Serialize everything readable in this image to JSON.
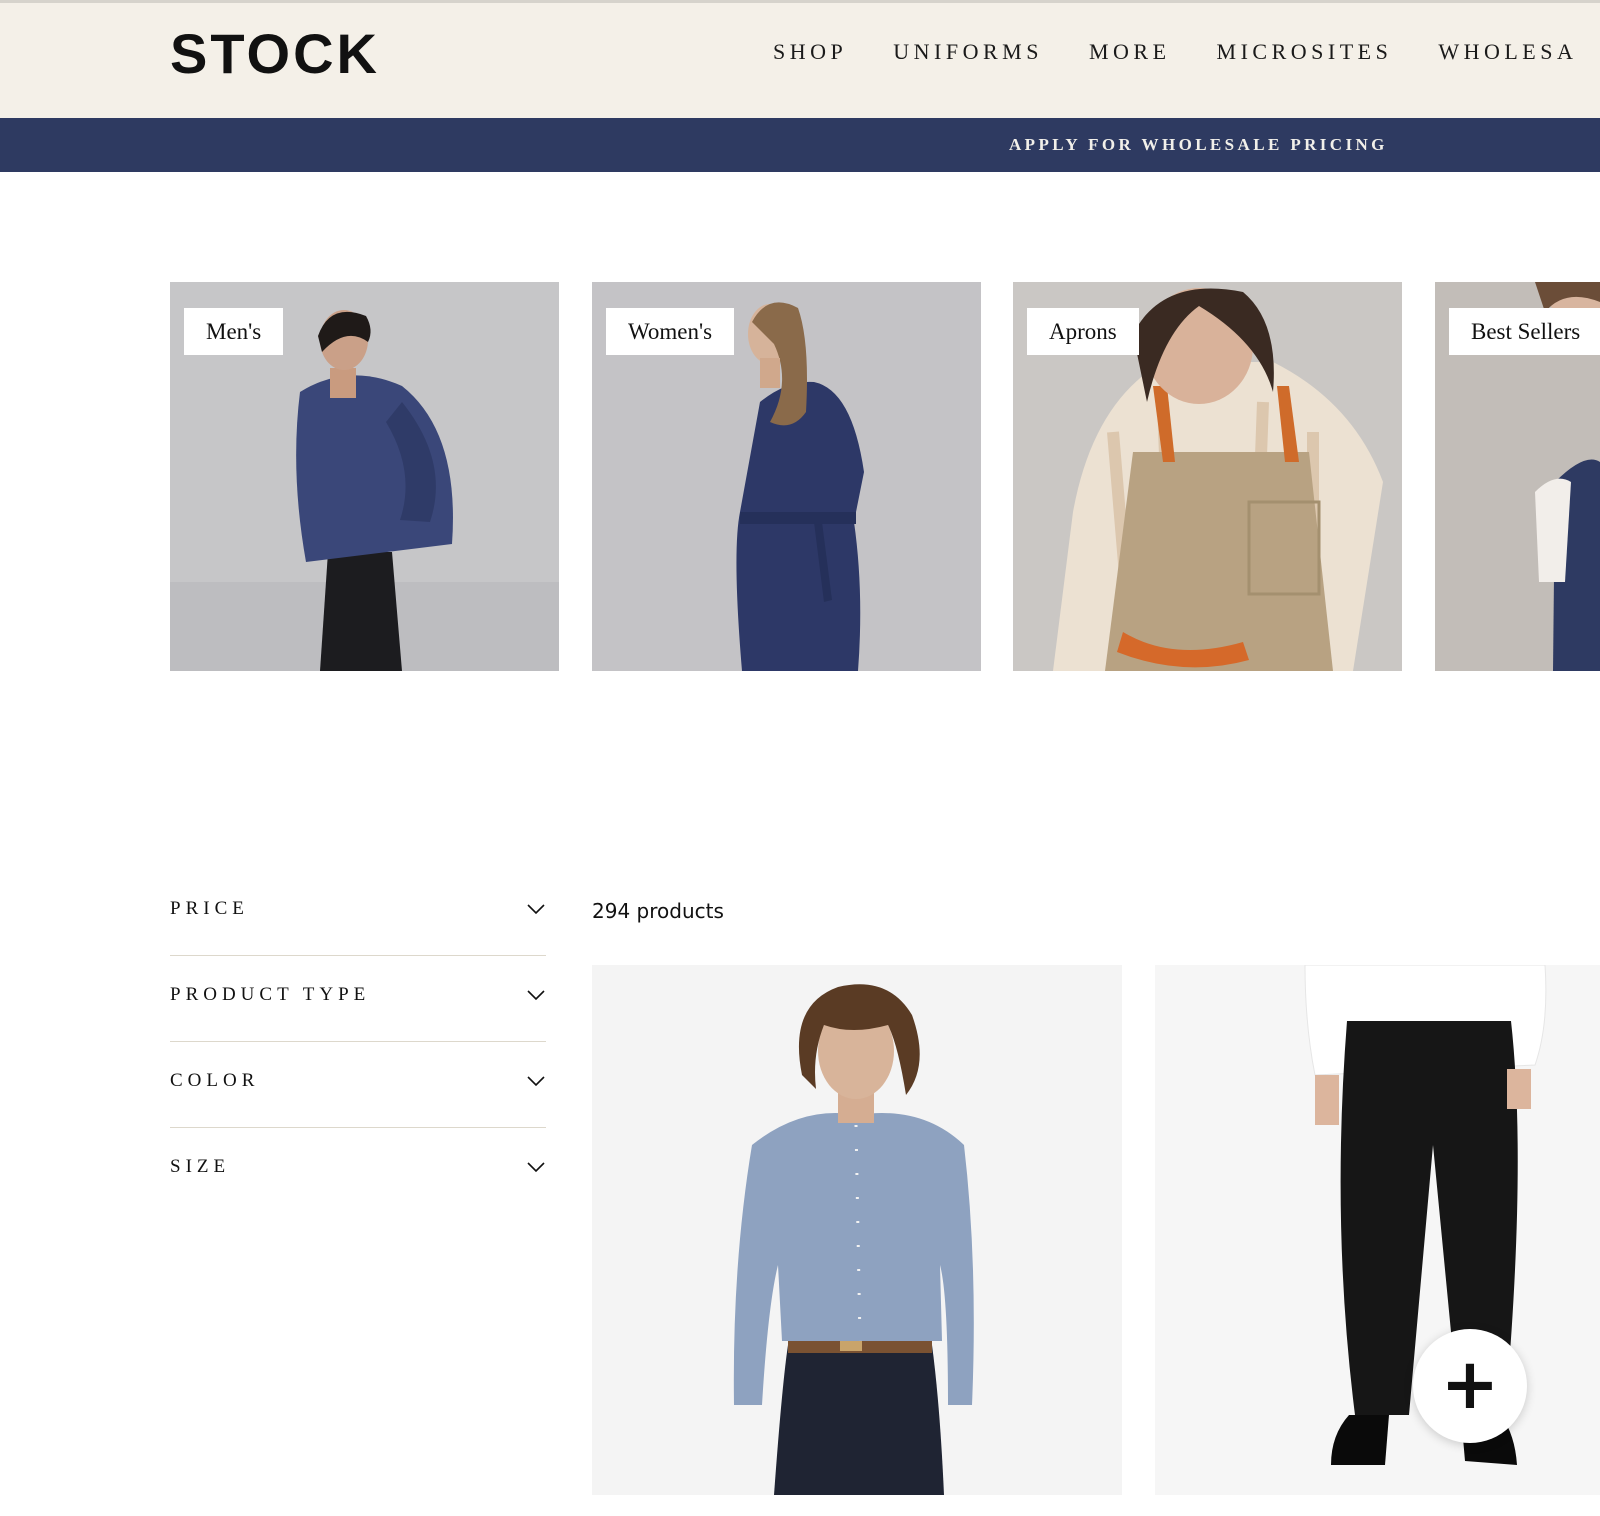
{
  "header": {
    "logo": "STOCK",
    "nav": [
      "SHOP",
      "UNIFORMS",
      "MORE",
      "MICROSITES",
      "WHOLESA"
    ]
  },
  "banner": {
    "text": "APPLY FOR WHOLESALE PRICING"
  },
  "collections": [
    {
      "label": "Men's"
    },
    {
      "label": "Women's"
    },
    {
      "label": "Aprons"
    },
    {
      "label": "Best Sellers"
    }
  ],
  "filters": [
    {
      "label": "PRICE",
      "icon": "chevron-down-icon"
    },
    {
      "label": "PRODUCT TYPE",
      "icon": "chevron-down-icon"
    },
    {
      "label": "COLOR",
      "icon": "chevron-down-icon"
    },
    {
      "label": "SIZE",
      "icon": "chevron-down-icon"
    }
  ],
  "results": {
    "count": "294 products"
  },
  "quick_add": {
    "icon": "plus-icon",
    "symbol": "+"
  },
  "colors": {
    "header_bg": "#f4f0e8",
    "banner_bg": "#2e3a61",
    "banner_text": "#f2f0ea"
  }
}
